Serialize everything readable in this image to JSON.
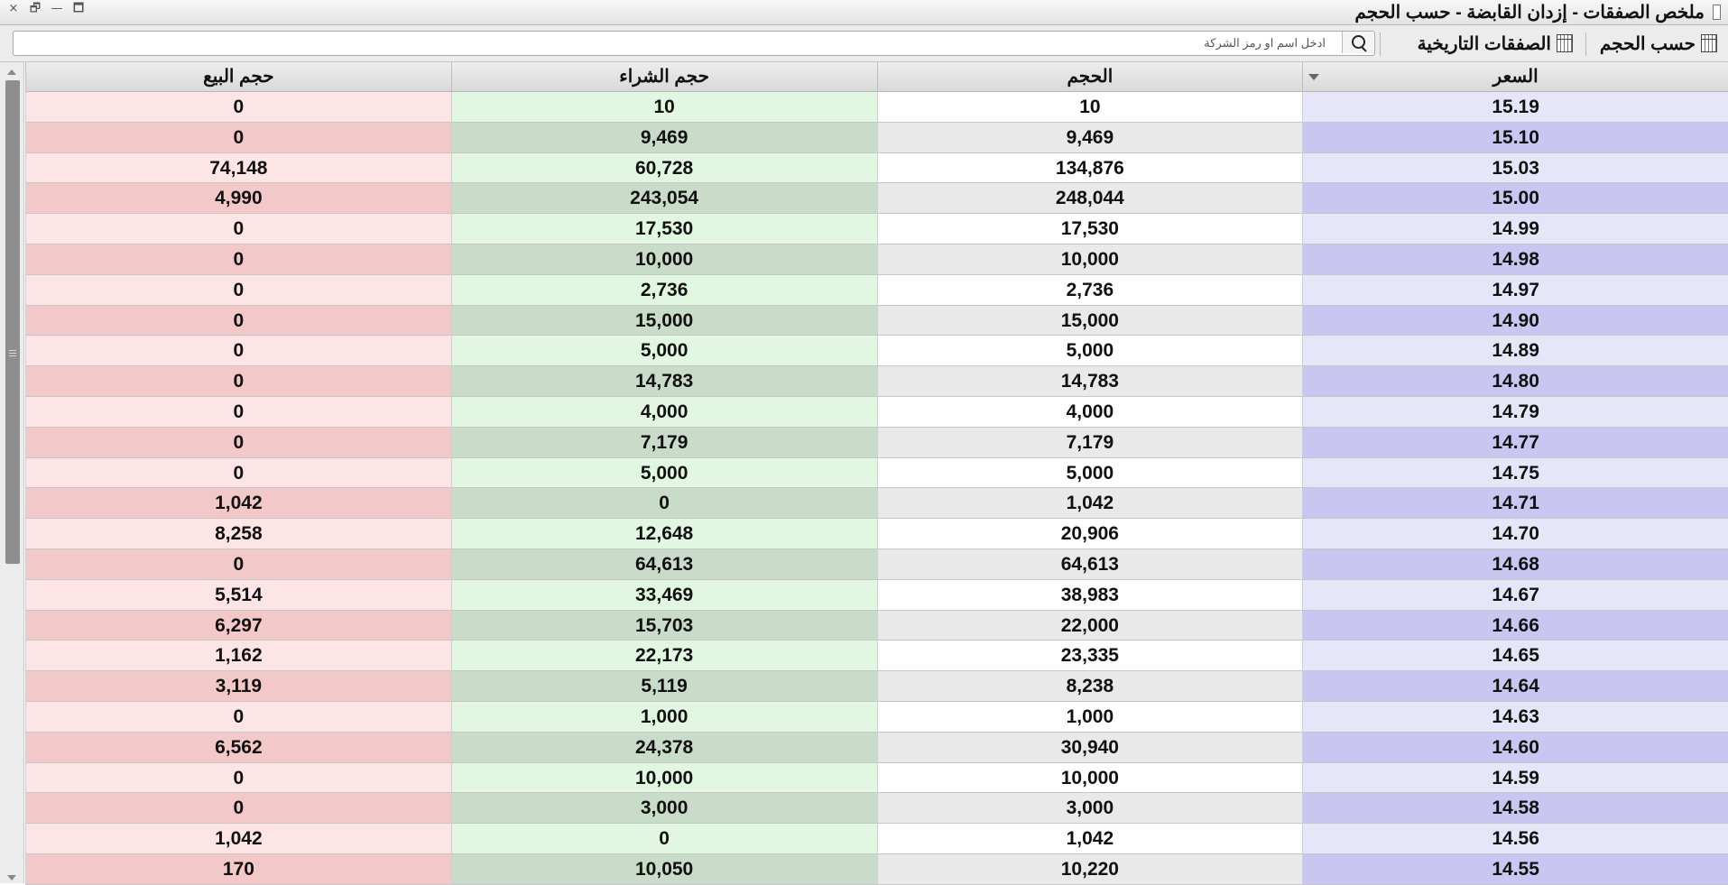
{
  "window": {
    "title": "ملخص الصفقات - إزدان القابضة - حسب الحجم",
    "controls": [
      "×",
      "🗗",
      "—",
      "🗖"
    ]
  },
  "toolbar": {
    "by_volume_label": "حسب الحجم",
    "historical_trades_label": "الصفقات التاريخية",
    "search_placeholder": "ادخل اسم او رمز الشركة"
  },
  "table": {
    "columns": [
      "السعر",
      "الحجم",
      "حجم الشراء",
      "حجم البيع"
    ],
    "sorted_column": "السعر",
    "rows": [
      [
        "15.19",
        "10",
        "10",
        "0"
      ],
      [
        "15.10",
        "9,469",
        "9,469",
        "0"
      ],
      [
        "15.03",
        "134,876",
        "60,728",
        "74,148"
      ],
      [
        "15.00",
        "248,044",
        "243,054",
        "4,990"
      ],
      [
        "14.99",
        "17,530",
        "17,530",
        "0"
      ],
      [
        "14.98",
        "10,000",
        "10,000",
        "0"
      ],
      [
        "14.97",
        "2,736",
        "2,736",
        "0"
      ],
      [
        "14.90",
        "15,000",
        "15,000",
        "0"
      ],
      [
        "14.89",
        "5,000",
        "5,000",
        "0"
      ],
      [
        "14.80",
        "14,783",
        "14,783",
        "0"
      ],
      [
        "14.79",
        "4,000",
        "4,000",
        "0"
      ],
      [
        "14.77",
        "7,179",
        "7,179",
        "0"
      ],
      [
        "14.75",
        "5,000",
        "5,000",
        "0"
      ],
      [
        "14.71",
        "1,042",
        "0",
        "1,042"
      ],
      [
        "14.70",
        "20,906",
        "12,648",
        "8,258"
      ],
      [
        "14.68",
        "64,613",
        "64,613",
        "0"
      ],
      [
        "14.67",
        "38,983",
        "33,469",
        "5,514"
      ],
      [
        "14.66",
        "22,000",
        "15,703",
        "6,297"
      ],
      [
        "14.65",
        "23,335",
        "22,173",
        "1,162"
      ],
      [
        "14.64",
        "8,238",
        "5,119",
        "3,119"
      ],
      [
        "14.63",
        "1,000",
        "1,000",
        "0"
      ],
      [
        "14.60",
        "30,940",
        "24,378",
        "6,562"
      ],
      [
        "14.59",
        "10,000",
        "10,000",
        "0"
      ],
      [
        "14.58",
        "3,000",
        "3,000",
        "0"
      ],
      [
        "14.56",
        "1,042",
        "0",
        "1,042"
      ],
      [
        "14.55",
        "10,220",
        "10,050",
        "170"
      ]
    ]
  },
  "colors": {
    "price_odd": "#e7e6f8",
    "price_even": "#c9c7f1",
    "buy_odd": "#e1f7e1",
    "buy_even": "#c9dbc9",
    "sell_odd": "#fde5e5",
    "sell_even": "#f3c8c8"
  }
}
